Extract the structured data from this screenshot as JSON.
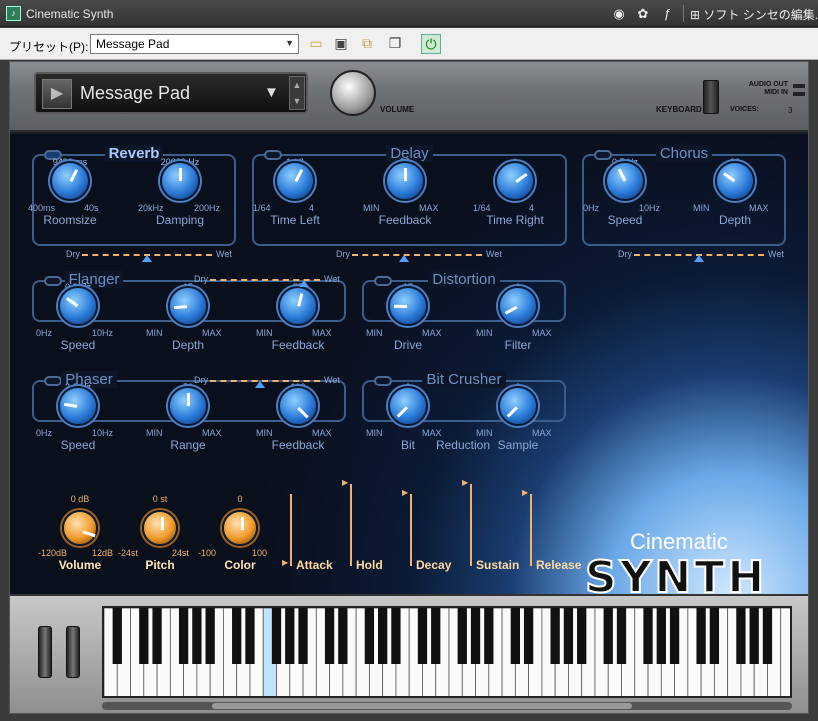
{
  "window": {
    "title": "Cinematic Synth",
    "synth_link": "ソフト シンセの編集..."
  },
  "toolbar": {
    "preset_label": "プリセット(P):",
    "preset_value": "Message Pad"
  },
  "header": {
    "preset_name": "Message Pad",
    "volume_label": "VOLUME",
    "keyboard_label": "KEYBOARD",
    "audio_out": "AUDIO OUT",
    "midi_in": "MIDI IN",
    "voices_label": "VOICES:",
    "voices_value": "3"
  },
  "effects": {
    "reverb": {
      "title": "Reverb",
      "enabled": true,
      "knobs": [
        {
          "value": "9490 ms",
          "min": "400ms",
          "max": "40s",
          "name": "Roomsize",
          "level": 0.6
        },
        {
          "value": "20000 Hz",
          "min": "20kHz",
          "max": "200Hz",
          "name": "Damping",
          "level": 0.5
        }
      ],
      "mix": {
        "dry": "Dry",
        "wet": "Wet",
        "level": 0.5
      }
    },
    "delay": {
      "title": "Delay",
      "enabled": false,
      "knobs": [
        {
          "value": "1 / 2",
          "min": "1/64",
          "max": "4",
          "name": "Time Left",
          "level": 0.6
        },
        {
          "value": "55",
          "min": "MIN",
          "max": "MAX",
          "name": "Feedback",
          "level": 0.5
        },
        {
          "value": "1",
          "min": "1/64",
          "max": "4",
          "name": "Time Right",
          "level": 0.7
        }
      ],
      "mix": {
        "dry": "Dry",
        "wet": "Wet",
        "level": 0.4
      }
    },
    "chorus": {
      "title": "Chorus",
      "enabled": false,
      "knobs": [
        {
          "value": "0.5 Hz",
          "min": "0Hz",
          "max": "10Hz",
          "name": "Speed",
          "level": 0.4
        },
        {
          "value": "30",
          "min": "MIN",
          "max": "MAX",
          "name": "Depth",
          "level": 0.3
        }
      ],
      "mix": {
        "dry": "Dry",
        "wet": "Wet",
        "level": 0.5
      }
    },
    "flanger": {
      "title": "Flanger",
      "enabled": false,
      "knobs": [
        {
          "value": "0.3 Hz",
          "min": "0Hz",
          "max": "10Hz",
          "name": "Speed",
          "level": 0.3
        },
        {
          "value": "15",
          "min": "MIN",
          "max": "MAX",
          "name": "Depth",
          "level": 0.15
        },
        {
          "value": "55",
          "min": "MIN",
          "max": "MAX",
          "name": "Feedback",
          "level": 0.55
        }
      ],
      "mix": {
        "dry": "Dry",
        "wet": "Wet",
        "level": 0.85
      }
    },
    "distortion": {
      "title": "Distortion",
      "enabled": false,
      "knobs": [
        {
          "value": "17",
          "min": "MIN",
          "max": "MAX",
          "name": "Drive",
          "level": 0.17
        },
        {
          "value": "6",
          "min": "MIN",
          "max": "MAX",
          "name": "Filter",
          "level": 0.06
        }
      ]
    },
    "phaser": {
      "title": "Phaser",
      "enabled": false,
      "knobs": [
        {
          "value": "2.0 Hz",
          "min": "0Hz",
          "max": "10Hz",
          "name": "Speed",
          "level": 0.2
        },
        {
          "value": "50",
          "min": "MIN",
          "max": "MAX",
          "name": "Range",
          "level": 0.5
        },
        {
          "value": "100",
          "min": "MIN",
          "max": "MAX",
          "name": "Feedback",
          "level": 1
        }
      ],
      "mix": {
        "dry": "Dry",
        "wet": "Wet",
        "level": 0.45
      }
    },
    "bitcrusher": {
      "title": "Bit Crusher",
      "enabled": false,
      "reduction_label": "Reduction",
      "knobs": [
        {
          "value": "0",
          "min": "MIN",
          "max": "MAX",
          "name": "Bit",
          "level": 0
        },
        {
          "value": "0",
          "min": "MIN",
          "max": "MAX",
          "name": "Sample",
          "level": 0
        }
      ]
    }
  },
  "bottom": {
    "knobs": [
      {
        "value": "0 dB",
        "min": "-120dB",
        "max": "12dB",
        "name": "Volume",
        "level": 0.9
      },
      {
        "value": "0 st",
        "min": "-24st",
        "max": "24st",
        "name": "Pitch",
        "level": 0.5
      },
      {
        "value": "0",
        "min": "-100",
        "max": "100",
        "name": "Color",
        "level": 0.5
      }
    ],
    "envelope": {
      "attack": "Attack",
      "hold": "Hold",
      "decay": "Decay",
      "sustain": "Sustain",
      "release": "Release"
    }
  },
  "logo": {
    "top": "Cinematic",
    "main": "SYNTH"
  }
}
